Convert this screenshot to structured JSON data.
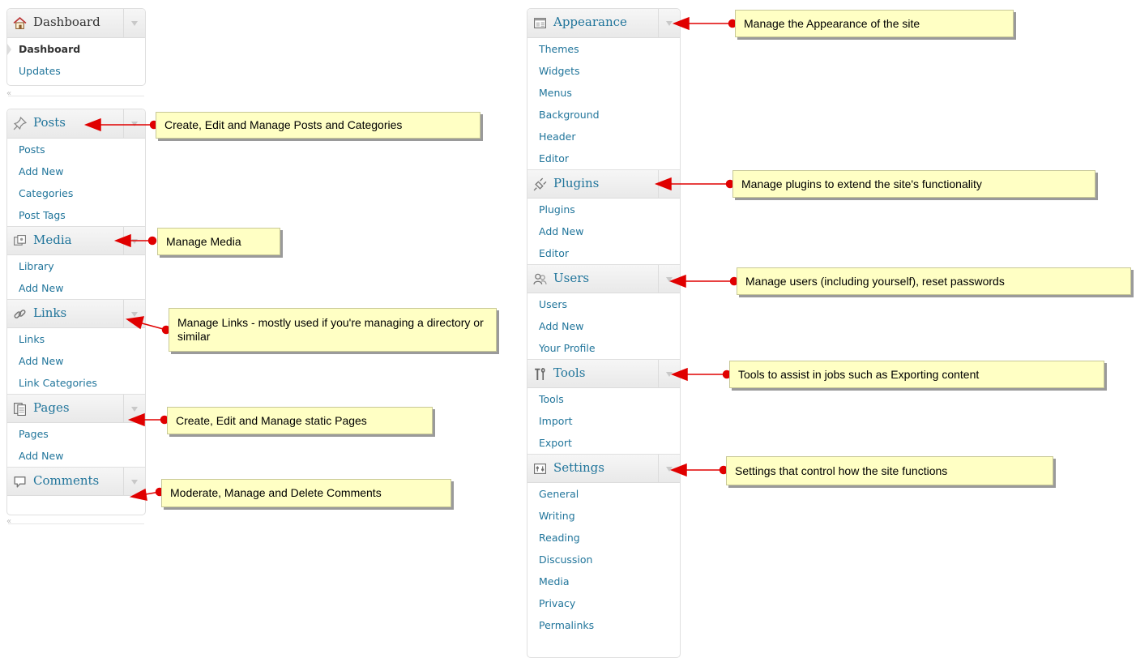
{
  "left_menu": {
    "dashboard": {
      "title": "Dashboard",
      "items": [
        "Dashboard",
        "Updates"
      ]
    },
    "sections": [
      {
        "title": "Posts",
        "items": [
          "Posts",
          "Add New",
          "Categories",
          "Post Tags"
        ]
      },
      {
        "title": "Media",
        "items": [
          "Library",
          "Add New"
        ]
      },
      {
        "title": "Links",
        "items": [
          "Links",
          "Add New",
          "Link Categories"
        ]
      },
      {
        "title": "Pages",
        "items": [
          "Pages",
          "Add New"
        ]
      },
      {
        "title": "Comments",
        "items": []
      }
    ]
  },
  "right_menu": {
    "sections": [
      {
        "title": "Appearance",
        "items": [
          "Themes",
          "Widgets",
          "Menus",
          "Background",
          "Header",
          "Editor"
        ]
      },
      {
        "title": "Plugins",
        "items": [
          "Plugins",
          "Add New",
          "Editor"
        ]
      },
      {
        "title": "Users",
        "items": [
          "Users",
          "Add New",
          "Your Profile"
        ]
      },
      {
        "title": "Tools",
        "items": [
          "Tools",
          "Import",
          "Export"
        ]
      },
      {
        "title": "Settings",
        "items": [
          "General",
          "Writing",
          "Reading",
          "Discussion",
          "Media",
          "Privacy",
          "Permalinks"
        ]
      }
    ]
  },
  "annotations": {
    "posts": "Create, Edit and Manage Posts and Categories",
    "media": "Manage Media",
    "links": "Manage Links - mostly used if you're managing a directory or similar",
    "pages": "Create, Edit and Manage static Pages",
    "comments": "Moderate, Manage and Delete Comments",
    "appearance": "Manage the Appearance of the site",
    "plugins": "Manage plugins to extend the site's functionality",
    "users": "Manage users (including yourself), reset passwords",
    "tools": "Tools to assist in jobs such as Exporting content",
    "settings": "Settings that control how the site functions"
  },
  "colors": {
    "link": "#21759b",
    "note_bg": "#ffffc4",
    "arrow": "#e00000"
  }
}
